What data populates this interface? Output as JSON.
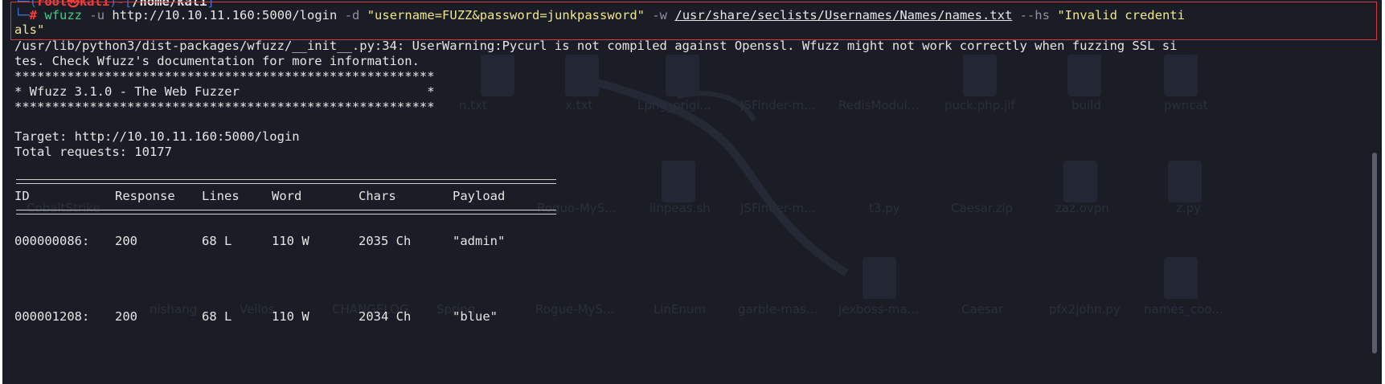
{
  "prompt": {
    "header_user": "root",
    "header_at": "㉿",
    "header_host": "kali",
    "header_dir": "/home/kali",
    "hash": "#",
    "cmd": "wfuzz",
    "opt_u": "-u",
    "url": "http://10.10.11.160:5000/login",
    "opt_d": "-d",
    "data": "\"username=FUZZ&password=junkpassword\"",
    "opt_w": "-w",
    "wordlist": "/usr/share/seclists/Usernames/Names/names.txt",
    "opt_hs": "--hs",
    "hs_value_part1": "\"Invalid credenti",
    "hs_value_part2": "als\""
  },
  "output": {
    "warning_line1": "/usr/lib/python3/dist-packages/wfuzz/__init__.py:34: UserWarning:Pycurl is not compiled against Openssl. Wfuzz might not work correctly when fuzzing SSL si",
    "warning_line2": "tes. Check Wfuzz's documentation for more information.",
    "banner_stars": "********************************************************",
    "banner_title": "* Wfuzz 3.1.0 - The Web Fuzzer                         *",
    "target": "Target: http://10.10.11.160:5000/login",
    "total_requests": "Total requests: 10177"
  },
  "table": {
    "headers": {
      "id": "ID",
      "response": "Response",
      "lines": "Lines",
      "word": "Word",
      "chars": "Chars",
      "payload": "Payload"
    },
    "rows": [
      {
        "id": "000000086:",
        "response": "200",
        "lines": "68 L",
        "word": "110 W",
        "chars": "2035 Ch",
        "payload": "\"admin\""
      },
      {
        "id": "000001208:",
        "response": "200",
        "lines": "68 L",
        "word": "110 W",
        "chars": "2034 Ch",
        "payload": "\"blue\""
      }
    ]
  },
  "desktop_ghost_labels": [
    "n.txt",
    "x.txt",
    "Lpng_origi...",
    "JSFinder-m...",
    "RedisModul...",
    "puck.php.jif",
    "build",
    "pwncat",
    "CobaltStrike",
    "Roguo-MyS...",
    "linpeas.sh",
    "JSFinder-m...",
    "t3.py",
    "Caesar.zip",
    "zaz.ovpn",
    "z.py",
    "nishang",
    "Veilos",
    "CHANGELOG",
    "Spring",
    "Rogue-MyS...",
    "LinEnum",
    "garble-mas...",
    "jexboss-ma...",
    "Caesar",
    "pfx2john.py",
    "names_coo..."
  ],
  "colors": {
    "background": "#1b1d26",
    "text": "#e6e6e6",
    "highlight_box": "#d63a3a",
    "string": "#f1e68a",
    "command": "#3fcf83",
    "argument": "#4a90ff"
  }
}
